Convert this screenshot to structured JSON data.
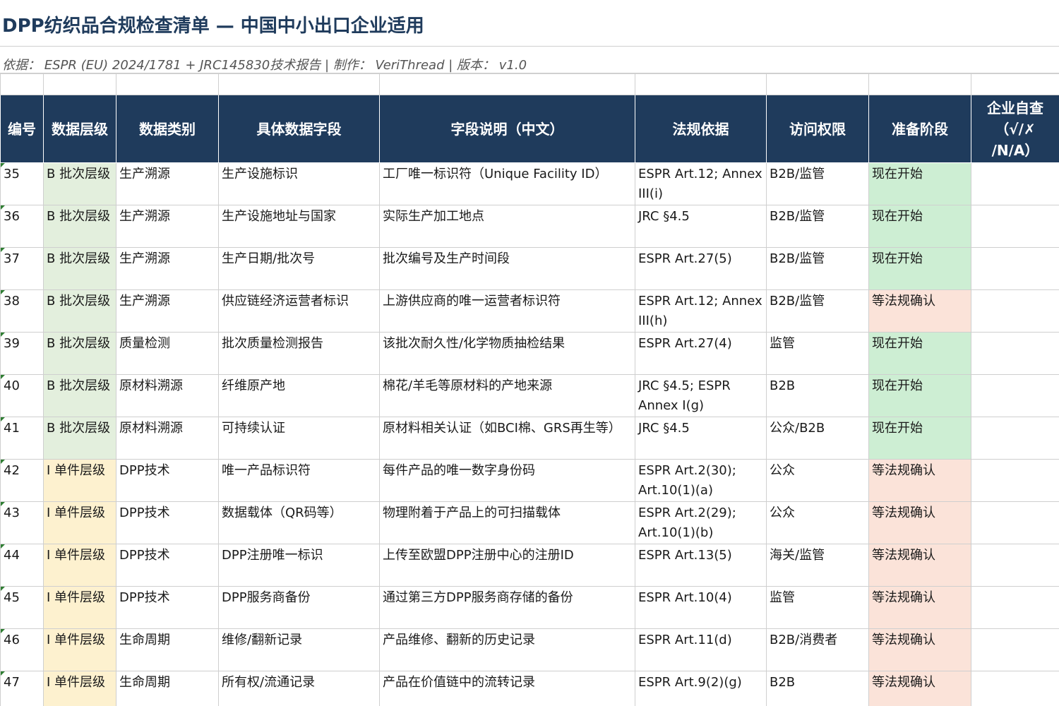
{
  "title": "DPP纺织品合规检查清单 — 中国中小出口企业适用",
  "source": "依据： ESPR (EU) 2024/1781 + JRC145830技术报告 | 制作： VeriThread | 版本： v1.0",
  "colors": {
    "header_bg": "#1f3b5c",
    "batch_level_bg": "#e3efdd",
    "item_level_bg": "#fdf1cf",
    "status_now_bg": "#cdeed3",
    "status_wait_bg": "#fbe3d9"
  },
  "columns": [
    "编号",
    "数据层级",
    "数据类别",
    "具体数据字段",
    "字段说明（中文）",
    "法规依据",
    "访问权限",
    "准备阶段",
    "企业自查\n（√/✗\n/N/A）"
  ],
  "rows": [
    {
      "num": "35",
      "level": "B 批次层级",
      "level_type": "B",
      "category": "生产溯源",
      "field": "生产设施标识",
      "desc": "工厂唯一标识符（Unique Facility ID）",
      "law": "ESPR Art.12; Annex III(i)",
      "access": "B2B/监管",
      "stage": "现在开始",
      "stage_type": "now",
      "check": ""
    },
    {
      "num": "36",
      "level": "B 批次层级",
      "level_type": "B",
      "category": "生产溯源",
      "field": "生产设施地址与国家",
      "desc": "实际生产加工地点",
      "law": "JRC §4.5",
      "access": "B2B/监管",
      "stage": "现在开始",
      "stage_type": "now",
      "check": ""
    },
    {
      "num": "37",
      "level": "B 批次层级",
      "level_type": "B",
      "category": "生产溯源",
      "field": "生产日期/批次号",
      "desc": "批次编号及生产时间段",
      "law": "ESPR Art.27(5)",
      "access": "B2B/监管",
      "stage": "现在开始",
      "stage_type": "now",
      "check": ""
    },
    {
      "num": "38",
      "level": "B 批次层级",
      "level_type": "B",
      "category": "生产溯源",
      "field": "供应链经济运营者标识",
      "desc": "上游供应商的唯一运营者标识符",
      "law": "ESPR Art.12; Annex III(h)",
      "access": "B2B/监管",
      "stage": "等法规确认",
      "stage_type": "wait",
      "check": ""
    },
    {
      "num": "39",
      "level": "B 批次层级",
      "level_type": "B",
      "category": "质量检测",
      "field": "批次质量检测报告",
      "desc": "该批次耐久性/化学物质抽检结果",
      "law": "ESPR Art.27(4)",
      "access": "监管",
      "stage": "现在开始",
      "stage_type": "now",
      "check": ""
    },
    {
      "num": "40",
      "level": "B 批次层级",
      "level_type": "B",
      "category": "原材料溯源",
      "field": "纤维原产地",
      "desc": "棉花/羊毛等原材料的产地来源",
      "law": "JRC §4.5; ESPR Annex I(g)",
      "access": "B2B",
      "stage": "现在开始",
      "stage_type": "now",
      "check": ""
    },
    {
      "num": "41",
      "level": "B 批次层级",
      "level_type": "B",
      "category": "原材料溯源",
      "field": "可持续认证",
      "desc": "原材料相关认证（如BCI棉、GRS再生等）",
      "law": "JRC §4.5",
      "access": "公众/B2B",
      "stage": "现在开始",
      "stage_type": "now",
      "check": ""
    },
    {
      "num": "42",
      "level": "I 单件层级",
      "level_type": "I",
      "category": "DPP技术",
      "field": "唯一产品标识符",
      "desc": "每件产品的唯一数字身份码",
      "law": "ESPR Art.2(30); Art.10(1)(a)",
      "access": "公众",
      "stage": "等法规确认",
      "stage_type": "wait",
      "check": ""
    },
    {
      "num": "43",
      "level": "I 单件层级",
      "level_type": "I",
      "category": "DPP技术",
      "field": "数据载体（QR码等）",
      "desc": "物理附着于产品上的可扫描载体",
      "law": "ESPR Art.2(29); Art.10(1)(b)",
      "access": "公众",
      "stage": "等法规确认",
      "stage_type": "wait",
      "check": ""
    },
    {
      "num": "44",
      "level": "I 单件层级",
      "level_type": "I",
      "category": "DPP技术",
      "field": "DPP注册唯一标识",
      "desc": "上传至欧盟DPP注册中心的注册ID",
      "law": "ESPR Art.13(5)",
      "access": "海关/监管",
      "stage": "等法规确认",
      "stage_type": "wait",
      "check": ""
    },
    {
      "num": "45",
      "level": "I 单件层级",
      "level_type": "I",
      "category": "DPP技术",
      "field": "DPP服务商备份",
      "desc": "通过第三方DPP服务商存储的备份",
      "law": "ESPR Art.10(4)",
      "access": "监管",
      "stage": "等法规确认",
      "stage_type": "wait",
      "check": ""
    },
    {
      "num": "46",
      "level": "I 单件层级",
      "level_type": "I",
      "category": "生命周期",
      "field": "维修/翻新记录",
      "desc": "产品维修、翻新的历史记录",
      "law": "ESPR Art.11(d)",
      "access": "B2B/消费者",
      "stage": "等法规确认",
      "stage_type": "wait",
      "check": ""
    },
    {
      "num": "47",
      "level": "I 单件层级",
      "level_type": "I",
      "category": "生命周期",
      "field": "所有权/流通记录",
      "desc": "产品在价值链中的流转记录",
      "law": "ESPR Art.9(2)(g)",
      "access": "B2B",
      "stage": "等法规确认",
      "stage_type": "wait",
      "check": ""
    }
  ]
}
